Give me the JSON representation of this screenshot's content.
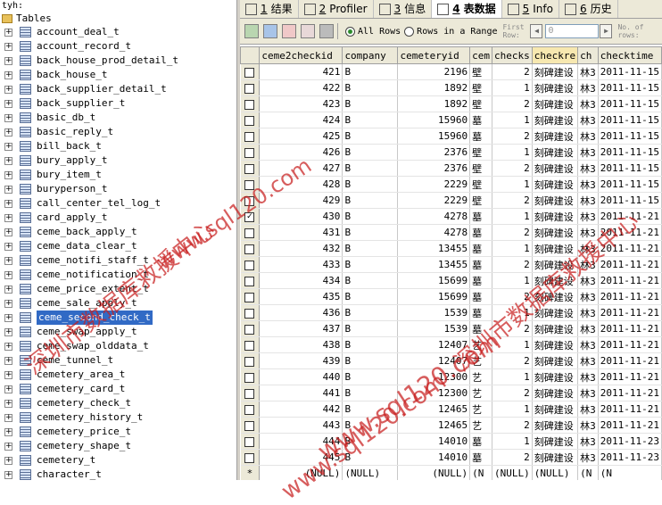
{
  "db_name": "tyh:",
  "tables_label": "Tables",
  "selected_table": "ceme_second_check_t",
  "tables": [
    "account_deal_t",
    "account_record_t",
    "back_house_prod_detail_t",
    "back_house_t",
    "back_supplier_detail_t",
    "back_supplier_t",
    "basic_db_t",
    "basic_reply_t",
    "bill_back_t",
    "bury_apply_t",
    "bury_item_t",
    "buryperson_t",
    "call_center_tel_log_t",
    "card_apply_t",
    "ceme_back_apply_t",
    "ceme_data_clear_t",
    "ceme_notifi_staff_t",
    "ceme_notification_t",
    "ceme_price_extent_t",
    "ceme_sale_apply_t",
    "ceme_second_check_t",
    "ceme_swap_apply_t",
    "ceme_swap_olddata_t",
    "ceme_tunnel_t",
    "cemetery_area_t",
    "cemetery_card_t",
    "cemetery_check_t",
    "cemetery_history_t",
    "cemetery_price_t",
    "cemetery_shape_t",
    "cemetery_t",
    "character_t"
  ],
  "tabs": [
    {
      "num": "1",
      "label": "结果",
      "icon": "grid-icon"
    },
    {
      "num": "2",
      "label": "Profiler",
      "icon": "profiler-icon"
    },
    {
      "num": "3",
      "label": "信息",
      "icon": "info-icon"
    },
    {
      "num": "4",
      "label": "表数据",
      "icon": "table-data-icon"
    },
    {
      "num": "5",
      "label": "Info",
      "icon": "info-chart-icon"
    },
    {
      "num": "6",
      "label": "历史",
      "icon": "history-icon"
    }
  ],
  "toolbar": {
    "all_rows": "All Rows",
    "rows_in_range": "Rows in a Range",
    "first_row": "First Row:",
    "first_row_value": "0",
    "no_of_rows": "No. of rows:"
  },
  "columns": [
    "",
    "ceme2checkid",
    "company",
    "cemeteryid",
    "cem",
    "checks",
    "checkre",
    "ch",
    "checktime"
  ],
  "rows": [
    {
      "id": "421",
      "company": "B",
      "cemeteryid": "2196",
      "cem": "壁",
      "checks": "2",
      "checkre": "刻碑建设",
      "ch": "林3",
      "time": "2011-11-15",
      "checked": false
    },
    {
      "id": "422",
      "company": "B",
      "cemeteryid": "1892",
      "cem": "壁",
      "checks": "1",
      "checkre": "刻碑建设",
      "ch": "林3",
      "time": "2011-11-15",
      "checked": false
    },
    {
      "id": "423",
      "company": "B",
      "cemeteryid": "1892",
      "cem": "壁",
      "checks": "2",
      "checkre": "刻碑建设",
      "ch": "林3",
      "time": "2011-11-15",
      "checked": false
    },
    {
      "id": "424",
      "company": "B",
      "cemeteryid": "15960",
      "cem": "墓",
      "checks": "1",
      "checkre": "刻碑建设",
      "ch": "林3",
      "time": "2011-11-15",
      "checked": false
    },
    {
      "id": "425",
      "company": "B",
      "cemeteryid": "15960",
      "cem": "墓",
      "checks": "2",
      "checkre": "刻碑建设",
      "ch": "林3",
      "time": "2011-11-15",
      "checked": false
    },
    {
      "id": "426",
      "company": "B",
      "cemeteryid": "2376",
      "cem": "壁",
      "checks": "1",
      "checkre": "刻碑建设",
      "ch": "林3",
      "time": "2011-11-15",
      "checked": false
    },
    {
      "id": "427",
      "company": "B",
      "cemeteryid": "2376",
      "cem": "壁",
      "checks": "2",
      "checkre": "刻碑建设",
      "ch": "林3",
      "time": "2011-11-15",
      "checked": false
    },
    {
      "id": "428",
      "company": "B",
      "cemeteryid": "2229",
      "cem": "壁",
      "checks": "1",
      "checkre": "刻碑建设",
      "ch": "林3",
      "time": "2011-11-15",
      "checked": false
    },
    {
      "id": "429",
      "company": "B",
      "cemeteryid": "2229",
      "cem": "壁",
      "checks": "2",
      "checkre": "刻碑建设",
      "ch": "林3",
      "time": "2011-11-15",
      "checked": false
    },
    {
      "id": "430",
      "company": "B",
      "cemeteryid": "4278",
      "cem": "墓",
      "checks": "1",
      "checkre": "刻碑建设",
      "ch": "林3",
      "time": "2011-11-21",
      "checked": true
    },
    {
      "id": "431",
      "company": "B",
      "cemeteryid": "4278",
      "cem": "墓",
      "checks": "2",
      "checkre": "刻碑建设",
      "ch": "林3",
      "time": "2011-11-21",
      "checked": false
    },
    {
      "id": "432",
      "company": "B",
      "cemeteryid": "13455",
      "cem": "墓",
      "checks": "1",
      "checkre": "刻碑建设",
      "ch": "林3",
      "time": "2011-11-21",
      "checked": false
    },
    {
      "id": "433",
      "company": "B",
      "cemeteryid": "13455",
      "cem": "墓",
      "checks": "2",
      "checkre": "刻碑建设",
      "ch": "林3",
      "time": "2011-11-21",
      "checked": false
    },
    {
      "id": "434",
      "company": "B",
      "cemeteryid": "15699",
      "cem": "墓",
      "checks": "1",
      "checkre": "刻碑建设",
      "ch": "林3",
      "time": "2011-11-21",
      "checked": false
    },
    {
      "id": "435",
      "company": "B",
      "cemeteryid": "15699",
      "cem": "墓",
      "checks": "2",
      "checkre": "刻碑建设",
      "ch": "林3",
      "time": "2011-11-21",
      "checked": false
    },
    {
      "id": "436",
      "company": "B",
      "cemeteryid": "1539",
      "cem": "墓",
      "checks": "1",
      "checkre": "刻碑建设",
      "ch": "林3",
      "time": "2011-11-21",
      "checked": false
    },
    {
      "id": "437",
      "company": "B",
      "cemeteryid": "1539",
      "cem": "墓",
      "checks": "2",
      "checkre": "刻碑建设",
      "ch": "林3",
      "time": "2011-11-21",
      "checked": false
    },
    {
      "id": "438",
      "company": "B",
      "cemeteryid": "12407",
      "cem": "艺",
      "checks": "1",
      "checkre": "刻碑建设",
      "ch": "林3",
      "time": "2011-11-21",
      "checked": false
    },
    {
      "id": "439",
      "company": "B",
      "cemeteryid": "12407",
      "cem": "艺",
      "checks": "2",
      "checkre": "刻碑建设",
      "ch": "林3",
      "time": "2011-11-21",
      "checked": false
    },
    {
      "id": "440",
      "company": "B",
      "cemeteryid": "12300",
      "cem": "艺",
      "checks": "1",
      "checkre": "刻碑建设",
      "ch": "林3",
      "time": "2011-11-21",
      "checked": false
    },
    {
      "id": "441",
      "company": "B",
      "cemeteryid": "12300",
      "cem": "艺",
      "checks": "2",
      "checkre": "刻碑建设",
      "ch": "林3",
      "time": "2011-11-21",
      "checked": false
    },
    {
      "id": "442",
      "company": "B",
      "cemeteryid": "12465",
      "cem": "艺",
      "checks": "1",
      "checkre": "刻碑建设",
      "ch": "林3",
      "time": "2011-11-21",
      "checked": false
    },
    {
      "id": "443",
      "company": "B",
      "cemeteryid": "12465",
      "cem": "艺",
      "checks": "2",
      "checkre": "刻碑建设",
      "ch": "林3",
      "time": "2011-11-21",
      "checked": false
    },
    {
      "id": "444",
      "company": "B",
      "cemeteryid": "14010",
      "cem": "墓",
      "checks": "1",
      "checkre": "刻碑建设",
      "ch": "林3",
      "time": "2011-11-23",
      "checked": false
    },
    {
      "id": "445",
      "company": "B",
      "cemeteryid": "14010",
      "cem": "墓",
      "checks": "2",
      "checkre": "刻碑建设",
      "ch": "林3",
      "time": "2011-11-23",
      "checked": false
    }
  ],
  "new_row": {
    "marker": "*",
    "null": "(NULL)",
    "short_null": "(N"
  },
  "watermarks": {
    "cn1": "深圳市数据库救援中心",
    "cn2": "深圳市数据库救援中心",
    "url1": "www.sql120.com",
    "url2": "www.sql120.com",
    "url3": "www.sql120.com"
  },
  "colors": {
    "accent": "#316ac5",
    "watermark": "#c81e1e",
    "bar": "#2a6f2a"
  }
}
